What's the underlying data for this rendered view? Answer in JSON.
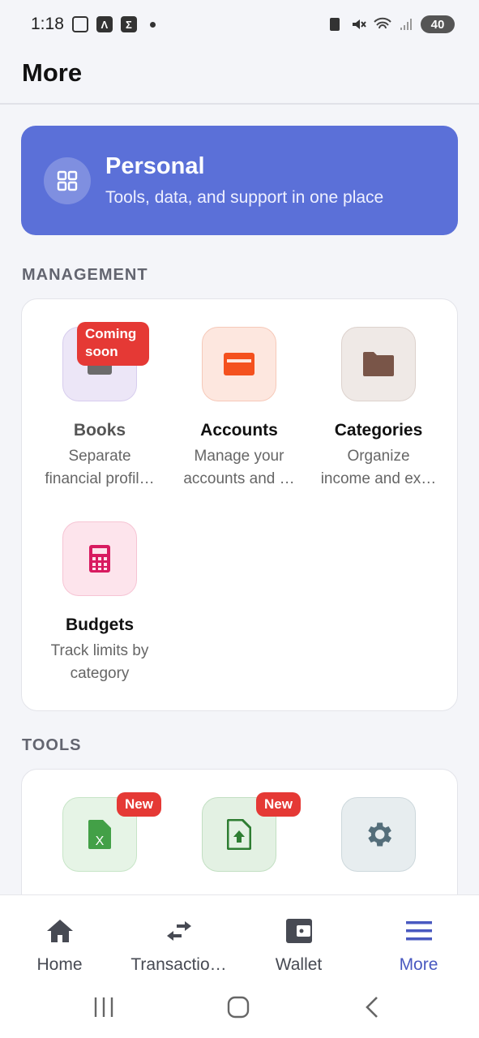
{
  "status": {
    "time": "1:18",
    "battery": "40"
  },
  "header": {
    "title": "More"
  },
  "hero": {
    "title": "Personal",
    "subtitle": "Tools, data, and support in one place",
    "icon": "grid-icon"
  },
  "sections": {
    "management": "MANAGEMENT",
    "tools": "TOOLS"
  },
  "management": [
    {
      "name": "Books",
      "desc1": "Separate",
      "desc2": "financial profil…",
      "badge": "Coming soon",
      "icon": "book-icon"
    },
    {
      "name": "Accounts",
      "desc1": "Manage your",
      "desc2": "accounts and …",
      "icon": "credit-card-icon"
    },
    {
      "name": "Categories",
      "desc1": "Organize",
      "desc2": "income and ex…",
      "icon": "folder-icon"
    },
    {
      "name": "Budgets",
      "desc1": "Track limits by",
      "desc2": "category",
      "icon": "calculator-icon"
    }
  ],
  "tools": [
    {
      "badge": "New",
      "icon": "excel-file-icon"
    },
    {
      "badge": "New",
      "icon": "upload-file-icon"
    },
    {
      "icon": "gear-icon"
    }
  ],
  "nav": {
    "home": "Home",
    "transactions": "Transactio…",
    "wallet": "Wallet",
    "more": "More"
  },
  "colors": {
    "hero": "#5b70d8",
    "active_nav": "#4959c0",
    "badge": "#e53935"
  }
}
